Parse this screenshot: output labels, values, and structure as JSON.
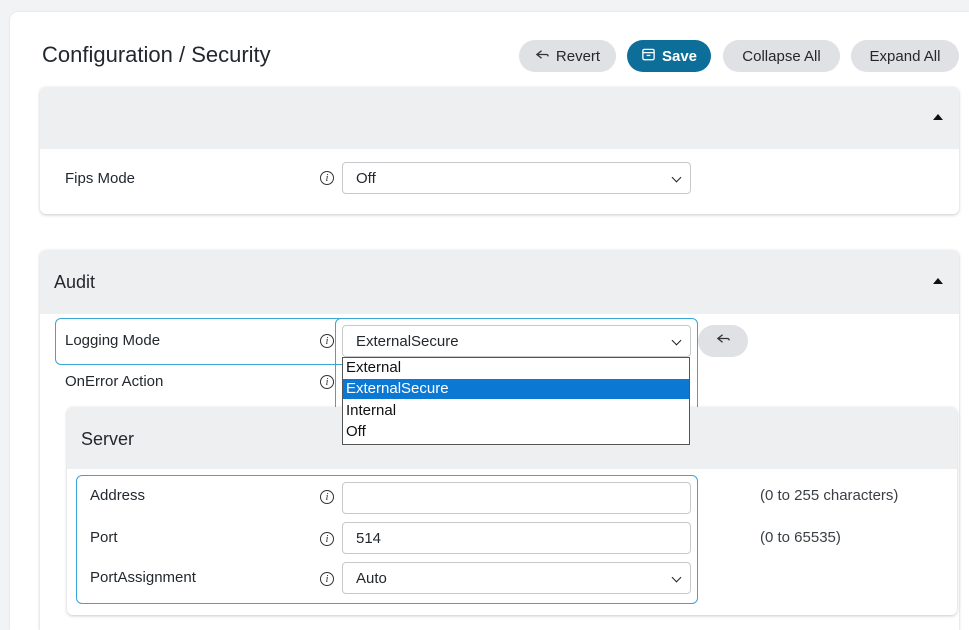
{
  "header": {
    "title": "Configuration / Security",
    "buttons": {
      "revert": "Revert",
      "save": "Save",
      "collapse_all": "Collapse All",
      "expand_all": "Expand All"
    }
  },
  "general": {
    "fips_mode": {
      "label": "Fips Mode",
      "value": "Off"
    }
  },
  "audit": {
    "title": "Audit",
    "logging_mode": {
      "label": "Logging Mode",
      "value": "ExternalSecure",
      "options": [
        "External",
        "ExternalSecure",
        "Internal",
        "Off"
      ]
    },
    "on_error_action": {
      "label": "OnError Action"
    },
    "server": {
      "title": "Server",
      "address": {
        "label": "Address",
        "value": "",
        "hint": "(0 to 255 characters)"
      },
      "port": {
        "label": "Port",
        "value": "514",
        "hint": "(0 to 65535)"
      },
      "port_assignment": {
        "label": "PortAssignment",
        "value": "Auto"
      }
    }
  },
  "colors": {
    "primary": "#0d6e9a",
    "focus": "#3aa6d6",
    "selected_option": "#0b78d4",
    "header_bg": "#eeeff1"
  },
  "icons": {
    "revert": "revert-arrow-icon",
    "save": "save-archive-icon",
    "info": "info-icon",
    "collapse": "caret-up-icon",
    "select": "chevron-down-icon"
  }
}
